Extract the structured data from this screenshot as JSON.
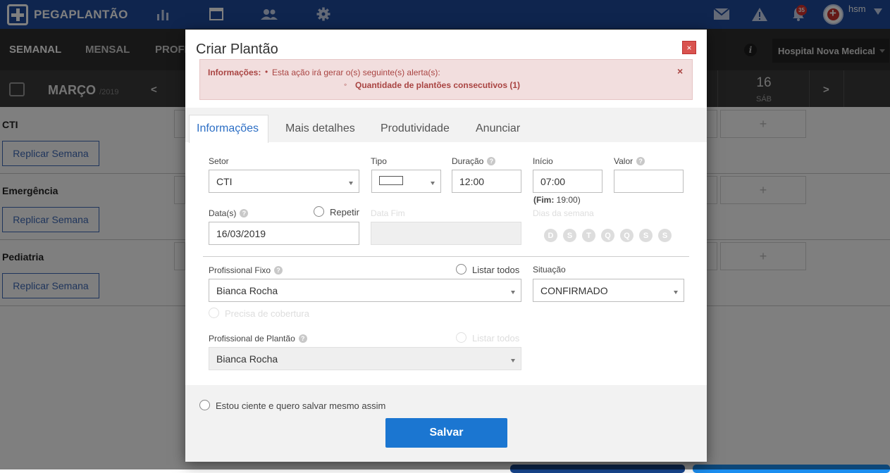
{
  "app": {
    "name": "PEGAPLANTÃO",
    "user": "hsm",
    "notifications": "35"
  },
  "subnav": {
    "tabs": [
      "SEMANAL",
      "MENSAL",
      "PROFI"
    ],
    "hospital": "Hospital Nova Medical"
  },
  "calendar": {
    "month": "MARÇO",
    "year": "/2019",
    "prev": "<",
    "next": ">",
    "day_num": "16",
    "day_name": "SÁB"
  },
  "sectors": [
    {
      "name": "CTI",
      "action": "Replicar Semana"
    },
    {
      "name": "Emergência",
      "action": "Replicar Semana"
    },
    {
      "name": "Pediatria",
      "action": "Replicar Semana"
    }
  ],
  "cell_plus": "+",
  "modal": {
    "title": "Criar Plantão",
    "close": "×",
    "alert": {
      "title": "Informações:",
      "message": "Esta ação irá gerar o(s) seguinte(s) alerta(s):",
      "item": "Quantidade de plantões consecutivos (1)",
      "close": "×"
    },
    "tabs": [
      "Informações",
      "Mais detalhes",
      "Produtividade",
      "Anunciar"
    ],
    "fields": {
      "setor_label": "Setor",
      "setor_value": "CTI",
      "tipo_label": "Tipo",
      "duracao_label": "Duração",
      "duracao_value": "12:00",
      "inicio_label": "Início",
      "inicio_value": "07:00",
      "fim_label": "(Fim:",
      "fim_value": "19:00)",
      "valor_label": "Valor",
      "valor_value": "",
      "datas_label": "Data(s)",
      "datas_value": "16/03/2019",
      "repetir_label": "Repetir",
      "data_fim_label": "Data Fim",
      "dias_label": "Dias da semana",
      "dias": [
        "D",
        "S",
        "T",
        "Q",
        "Q",
        "S",
        "S"
      ],
      "prof_fixo_label": "Profissional Fixo",
      "prof_fixo_value": "Bianca Rocha",
      "listar_todos": "Listar todos",
      "situacao_label": "Situação",
      "situacao_value": "CONFIRMADO",
      "precisa_cobertura": "Precisa de cobertura",
      "prof_plantao_label": "Profissional de Plantão",
      "prof_plantao_value": "Bianca Rocha",
      "listar_todos_2": "Listar todos"
    },
    "ciente_label": "Estou ciente e quero salvar mesmo assim",
    "save": "Salvar"
  },
  "colors": {
    "topbar": "#1f4b9c",
    "primary": "#1b76d1",
    "alert_bg": "#f2dede",
    "alert_text": "#a94442"
  }
}
